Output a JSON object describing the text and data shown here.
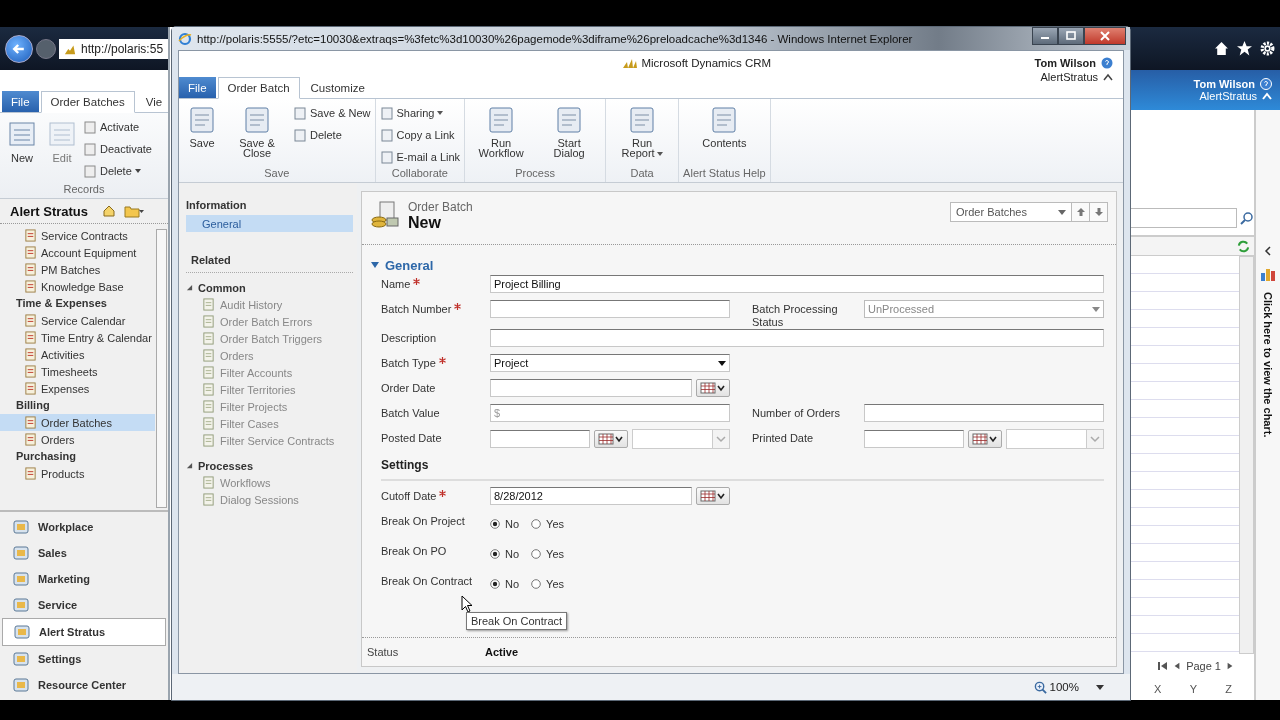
{
  "background_window": {
    "address": "http://polaris:55",
    "tabs": [
      {
        "label": "File",
        "kind": "file",
        "selected": false
      },
      {
        "label": "Order Batches",
        "kind": "tab",
        "selected": true
      },
      {
        "label": "Vie",
        "kind": "tab",
        "selected": false
      }
    ],
    "ribbon": {
      "large": [
        {
          "label": "New",
          "disabled": false
        },
        {
          "label": "Edit",
          "disabled": true
        }
      ],
      "small": [
        {
          "label": "Activate",
          "dropdown": false
        },
        {
          "label": "Deactivate",
          "dropdown": false
        },
        {
          "label": "Delete",
          "dropdown": true
        }
      ],
      "group": "Records"
    },
    "area_title": "Alert Stratus",
    "nav": [
      {
        "items": [
          {
            "label": "Service Contracts",
            "selected": false
          },
          {
            "label": "Account Equipment",
            "selected": false
          },
          {
            "label": "PM Batches",
            "selected": false
          },
          {
            "label": "Knowledge Base",
            "selected": false
          }
        ]
      },
      {
        "title": "Time & Expenses",
        "items": [
          {
            "label": "Service Calendar",
            "selected": false
          },
          {
            "label": "Time Entry & Calendar",
            "selected": false
          },
          {
            "label": "Activities",
            "selected": false
          },
          {
            "label": "Timesheets",
            "selected": false
          },
          {
            "label": "Expenses",
            "selected": false
          }
        ]
      },
      {
        "title": "Billing",
        "items": [
          {
            "label": "Order Batches",
            "selected": true
          },
          {
            "label": "Orders",
            "selected": false
          }
        ]
      },
      {
        "title": "Purchasing",
        "items": [
          {
            "label": "Products",
            "selected": false
          }
        ]
      }
    ],
    "workspaces": [
      {
        "label": "Workplace",
        "selected": false
      },
      {
        "label": "Sales",
        "selected": false
      },
      {
        "label": "Marketing",
        "selected": false
      },
      {
        "label": "Service",
        "selected": false
      },
      {
        "label": "Alert Stratus",
        "selected": true
      },
      {
        "label": "Settings",
        "selected": false
      },
      {
        "label": "Resource Center",
        "selected": false
      }
    ],
    "user": {
      "name": "Tom Wilson",
      "org": "AlertStratus"
    },
    "grid": {
      "pager": "Page 1",
      "jump_letters": [
        "X",
        "Y",
        "Z"
      ],
      "chart_hint": "Click here to view the chart."
    }
  },
  "dialog": {
    "title": "http://polaris:5555/?etc=10030&extraqs=%3fetc%3d10030%26pagemode%3diframe%26preloadcache%3d1346 - Windows Internet Explorer",
    "brand": "Microsoft Dynamics CRM",
    "user": {
      "name": "Tom Wilson",
      "org": "AlertStratus"
    },
    "tabs": [
      {
        "label": "File",
        "kind": "file",
        "selected": false
      },
      {
        "label": "Order Batch",
        "kind": "tab",
        "selected": true
      },
      {
        "label": "Customize",
        "kind": "tab",
        "selected": false
      }
    ],
    "ribbon": [
      {
        "label": "Save",
        "buttons": [
          {
            "label": "Save",
            "kind": "large",
            "dropdown": false
          },
          {
            "label": "Save & Close",
            "kind": "large",
            "dropdown": false
          },
          {
            "label": "Save & New",
            "kind": "small",
            "dropdown": false
          },
          {
            "label": "Delete",
            "kind": "small",
            "dropdown": false
          }
        ]
      },
      {
        "label": "Collaborate",
        "buttons": [
          {
            "label": "Sharing",
            "kind": "small",
            "dropdown": true
          },
          {
            "label": "Copy a Link",
            "kind": "small",
            "dropdown": false
          },
          {
            "label": "E-mail a Link",
            "kind": "small",
            "dropdown": false
          }
        ]
      },
      {
        "label": "Process",
        "buttons": [
          {
            "label": "Run Workflow",
            "kind": "large",
            "dropdown": false
          },
          {
            "label": "Start Dialog",
            "kind": "large",
            "dropdown": false
          }
        ]
      },
      {
        "label": "Data",
        "buttons": [
          {
            "label": "Run Report",
            "kind": "large",
            "dropdown": true
          }
        ]
      },
      {
        "label": "Alert Status Help",
        "buttons": [
          {
            "label": "Contents",
            "kind": "large",
            "dropdown": false
          }
        ]
      }
    ],
    "nav": {
      "information": {
        "title": "Information",
        "items": [
          {
            "label": "General",
            "selected": true
          }
        ]
      },
      "related": {
        "title": "Related",
        "groups": [
          {
            "title": "Common",
            "items": [
              {
                "label": "Audit History",
                "selected": false
              },
              {
                "label": "Order Batch Errors",
                "selected": false
              },
              {
                "label": "Order Batch Triggers",
                "selected": false
              },
              {
                "label": "Orders",
                "selected": false
              },
              {
                "label": "Filter Accounts",
                "selected": false
              },
              {
                "label": "Filter Territories",
                "selected": false
              },
              {
                "label": "Filter Projects",
                "selected": false
              },
              {
                "label": "Filter Cases",
                "selected": false
              },
              {
                "label": "Filter Service Contracts",
                "selected": false
              }
            ]
          },
          {
            "title": "Processes",
            "items": [
              {
                "label": "Workflows",
                "selected": false
              },
              {
                "label": "Dialog Sessions",
                "selected": false
              }
            ]
          }
        ]
      }
    },
    "form": {
      "entity": "Order Batch",
      "record": "New",
      "record_set": "Order Batches",
      "sections": [
        {
          "title": "General",
          "kind": "section",
          "rows": [
            {
              "fields": [
                {
                  "label": "Name",
                  "required": true,
                  "kind": "text",
                  "value": "Project Billing"
                }
              ]
            },
            {
              "fields": [
                {
                  "label": "Batch Number",
                  "required": true,
                  "kind": "text"
                },
                {
                  "label": "Batch Processing Status",
                  "required": false,
                  "kind": "select",
                  "value": "UnProcessed",
                  "disabled": true
                }
              ]
            },
            {
              "fields": [
                {
                  "label": "Description",
                  "required": false,
                  "kind": "text"
                }
              ]
            },
            {
              "fields": [
                {
                  "label": "Batch Type",
                  "required": true,
                  "kind": "select",
                  "value": "Project",
                  "disabled": false
                }
              ]
            },
            {
              "fields": [
                {
                  "label": "Order Date",
                  "required": false,
                  "kind": "date"
                }
              ]
            },
            {
              "fields": [
                {
                  "label": "Batch Value",
                  "required": false,
                  "kind": "currency",
                  "symbol": "$"
                },
                {
                  "label": "Number of Orders",
                  "required": false,
                  "kind": "text"
                }
              ]
            },
            {
              "fields": [
                {
                  "label": "Posted Date",
                  "required": false,
                  "kind": "datetime"
                },
                {
                  "label": "Printed Date",
                  "required": false,
                  "kind": "datetime"
                }
              ]
            }
          ]
        },
        {
          "title": "Settings",
          "kind": "subsection",
          "rows": [
            {
              "fields": [
                {
                  "label": "Cutoff Date",
                  "required": true,
                  "kind": "date",
                  "value": "8/28/2012"
                }
              ]
            },
            {
              "fields": [
                {
                  "label": "Break On Project",
                  "required": false,
                  "kind": "radio",
                  "options": [
                    {
                      "label": "No",
                      "selected": true
                    },
                    {
                      "label": "Yes",
                      "selected": false
                    }
                  ]
                }
              ]
            },
            {
              "fields": [
                {
                  "label": "Break On PO",
                  "required": false,
                  "kind": "radio",
                  "options": [
                    {
                      "label": "No",
                      "selected": true
                    },
                    {
                      "label": "Yes",
                      "selected": false
                    }
                  ]
                }
              ]
            },
            {
              "fields": [
                {
                  "label": "Break On Contract",
                  "required": false,
                  "kind": "radio",
                  "options": [
                    {
                      "label": "No",
                      "selected": true
                    },
                    {
                      "label": "Yes",
                      "selected": false
                    }
                  ]
                }
              ]
            }
          ]
        }
      ],
      "status_label": "Status",
      "status": "Active"
    },
    "tooltip": "Break On Contract",
    "zoom": "100%"
  }
}
